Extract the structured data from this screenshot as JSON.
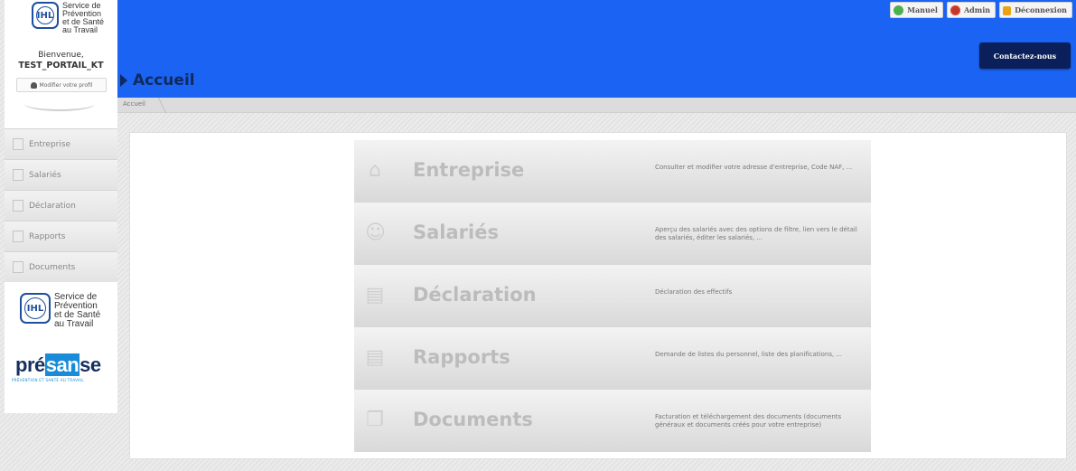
{
  "header": {
    "page_title": "Accueil",
    "links": [
      {
        "label": "Manuel",
        "icon": "help-icon"
      },
      {
        "label": "Admin",
        "icon": "gear-icon"
      },
      {
        "label": "Déconnexion",
        "icon": "lock-icon"
      }
    ],
    "contact_label": "Contactez-nous",
    "bg_color": "#1b63f2",
    "contact_color": "#0b1f5a"
  },
  "breadcrumb": {
    "items": [
      "Accueil"
    ]
  },
  "logo": {
    "lines": [
      "Service de",
      "Prévention",
      "et de Santé",
      "au Travail"
    ],
    "mark": "IHL"
  },
  "user": {
    "greeting": "Bienvenue,",
    "name": "TEST_PORTAIL_KT",
    "profile_label": "Modifier votre profil"
  },
  "nav": {
    "items": [
      {
        "label": "Entreprise",
        "icon": "building-icon"
      },
      {
        "label": "Salariés",
        "icon": "people-icon"
      },
      {
        "label": "Déclaration",
        "icon": "document-icon"
      },
      {
        "label": "Rapports",
        "icon": "report-icon"
      },
      {
        "label": "Documents",
        "icon": "documents-icon"
      }
    ]
  },
  "presanse": {
    "pre": "pré",
    "hl": "san",
    "post": "se",
    "tagline": "PRÉVENTION ET SANTÉ AU TRAVAIL"
  },
  "tiles": [
    {
      "title": "Entreprise",
      "desc": "Consulter et modifier votre adresse d'entreprise, Code NAF, ...",
      "icon": "house-icon"
    },
    {
      "title": "Salariés",
      "desc": "Aperçu des salariés avec des options de filtre, lien vers le détail des salariés, éditer les salariés, ...",
      "icon": "people-icon"
    },
    {
      "title": "Déclaration",
      "desc": "Déclaration des effectifs",
      "icon": "document-icon"
    },
    {
      "title": "Rapports",
      "desc": "Demande de listes du personnel, liste des planifications, ...",
      "icon": "report-icon"
    },
    {
      "title": "Documents",
      "desc": "Facturation et téléchargement des documents (documents généraux et documents créés pour votre entreprise)",
      "icon": "documents-icon"
    }
  ]
}
